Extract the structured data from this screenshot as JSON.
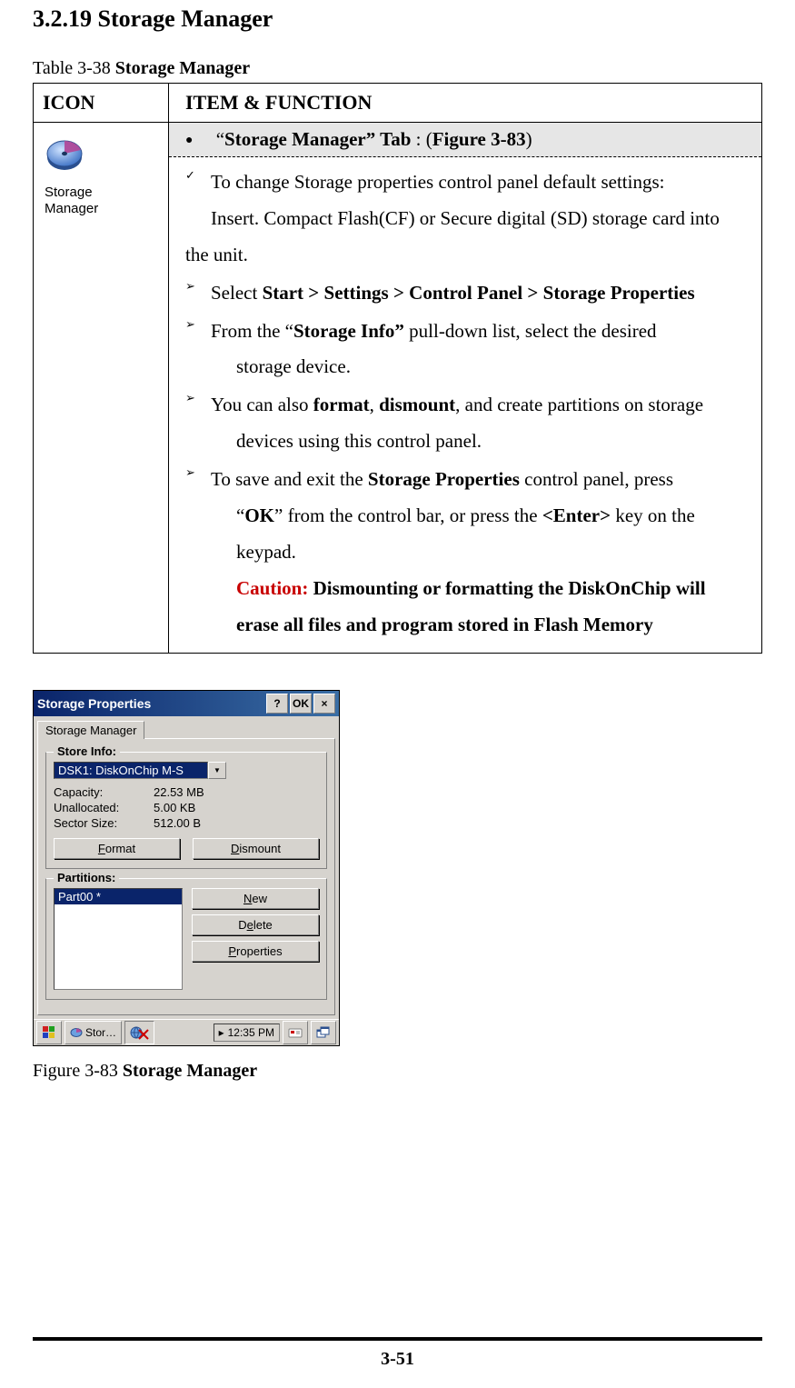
{
  "section_title": "3.2.19 Storage Manager",
  "table_caption_prefix": "Table 3-38 ",
  "table_caption_bold": "Storage Manager",
  "table_headers": {
    "icon": "ICON",
    "func": "ITEM & FUNCTION"
  },
  "icon_label": "Storage\nManager",
  "tab_line": {
    "open_quote": "“",
    "name": "Storage Manager",
    "close_quote_tab": "” Tab",
    "colon": " : (",
    "fig_ref": "Figure 3-83",
    "close": ")"
  },
  "body": {
    "change_line": "To change Storage properties control panel default settings:",
    "insert_line": "Insert. Compact Flash(CF) or Secure digital (SD) storage card into",
    "the_unit": "the unit.",
    "step1_prefix": "Select ",
    "step1_bold": "Start > Settings > Control Panel > Storage Properties",
    "step2_prefix": "From the “",
    "step2_bold": "Storage Info”",
    "step2_suffix": " pull-down list, select the desired",
    "step2_line2": "storage device.",
    "step3_a": "You can also ",
    "step3_b_bold": "format",
    "step3_c": ", ",
    "step3_d_bold": "dismount",
    "step3_e": ", and create partitions on storage",
    "step3_line2": "devices using this control panel.",
    "step4_a": "To save and exit the ",
    "step4_b_bold": "Storage Properties",
    "step4_c": " control panel, press",
    "step4_line2_a": "“",
    "step4_line2_b_bold": "OK",
    "step4_line2_c": "” from the control bar, or press the ",
    "step4_line2_d_bold": "<Enter>",
    "step4_line2_e": " key on the",
    "step4_line3": "keypad.",
    "caution_label": "Caution: ",
    "caution_rest1": "Dismounting or formatting the DiskOnChip will",
    "caution_rest2": "erase all files and program stored in Flash Memory"
  },
  "ce": {
    "title": "Storage Properties",
    "help": "?",
    "ok": "OK",
    "close": "×",
    "tab": "Storage Manager",
    "group1_legend": "Store Info:",
    "combo_value": "DSK1: DiskOnChip M-S",
    "rows": {
      "capacity_k": "Capacity:",
      "capacity_v": "22.53 MB",
      "unalloc_k": "Unallocated:",
      "unalloc_v": "5.00 KB",
      "sector_k": "Sector Size:",
      "sector_v": "512.00 B"
    },
    "format_btn": "Format",
    "dismount_btn": "Dismount",
    "group2_legend": "Partitions:",
    "list_item": "Part00 *",
    "new_btn": "New",
    "delete_btn": "Delete",
    "props_btn": "Properties",
    "task_app": "Stor…",
    "task_sep": "▸",
    "clock": "12:35 PM"
  },
  "fig_caption_prefix": "Figure 3-83 ",
  "fig_caption_bold": "Storage Manager",
  "page_number": "3-51"
}
